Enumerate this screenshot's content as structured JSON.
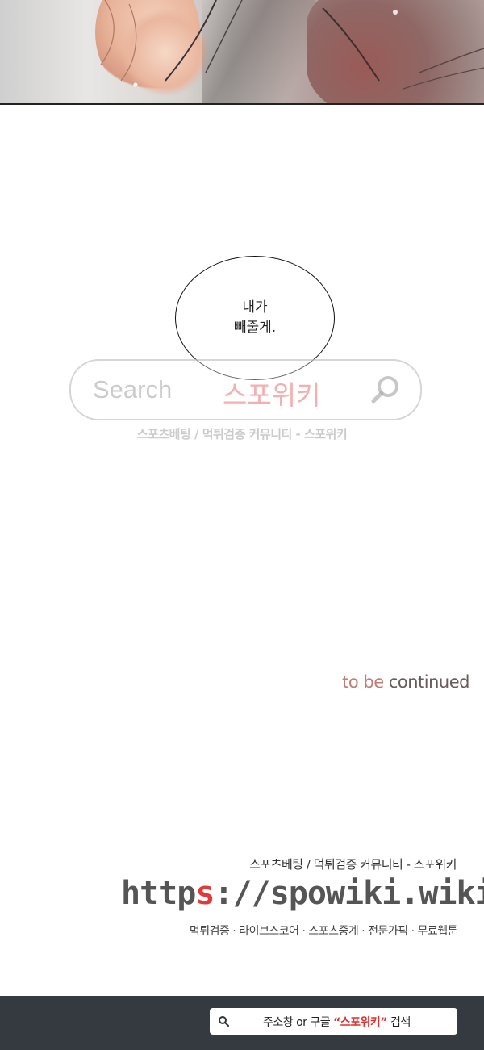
{
  "bubble": {
    "line1": "내가",
    "line2": "빼줄게."
  },
  "watermark_search": {
    "placeholder": "Search",
    "brand": "스포위키",
    "caption": "스포츠베팅 / 먹튀검증 커뮤니티 - 스포위키",
    "icon": "search-icon"
  },
  "ending": {
    "prefix": "to be ",
    "suffix": "continued"
  },
  "footer": {
    "tagline": "스포츠베팅 / 먹튀검증 커뮤니티 - 스포위키",
    "url_prefix": "http",
    "url_highlight": "s",
    "url_rest": "://spowiki.wiki",
    "services": "먹튀검증 · 라이브스코어 · 스포츠중계 · 전문가픽 · 무료웹툰"
  },
  "bottom_bar": {
    "icon": "search-icon",
    "text_before": "주소창 or 구글 ",
    "quoted": "“스포위키”",
    "text_after": " 검색"
  },
  "colors": {
    "accent_red": "#e23a3a",
    "bar_bg": "#353a40"
  }
}
